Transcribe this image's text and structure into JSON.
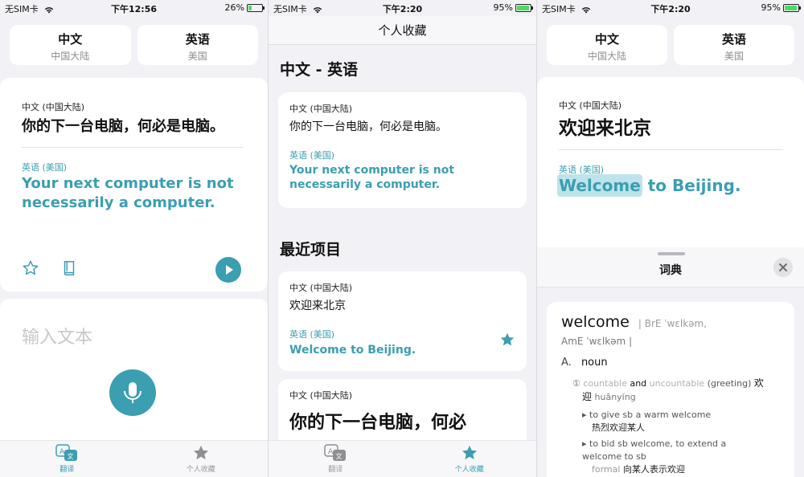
{
  "screen1": {
    "status": {
      "carrier": "无SIM卡",
      "time": "下午12:56",
      "battery": "26%"
    },
    "source_lang": {
      "name": "中文",
      "region": "中国大陆"
    },
    "target_lang": {
      "name": "英语",
      "region": "美国"
    },
    "source_label": "中文 (中国大陆)",
    "source_text": "你的下一台电脑，何必是电脑。",
    "target_label": "英语 (美国)",
    "target_text": "Your next computer is not necessarily a computer.",
    "input_placeholder": "输入文本",
    "tabs": [
      {
        "label": "翻译",
        "icon": "translate-icon"
      },
      {
        "label": "个人收藏",
        "icon": "star-icon"
      }
    ]
  },
  "screen2": {
    "status": {
      "carrier": "无SIM卡",
      "time": "下午2:20",
      "battery": "95%"
    },
    "title": "个人收藏",
    "favorites_section": "中文 - 英语",
    "favorite": {
      "source_label": "中文 (中国大陆)",
      "source_text": "你的下一台电脑，何必是电脑。",
      "target_label": "英语 (美国)",
      "target_text": "Your next computer is not necessarily a computer."
    },
    "recent_section": "最近项目",
    "recent": [
      {
        "source_label": "中文 (中国大陆)",
        "source_text": "欢迎来北京",
        "target_label": "英语 (美国)",
        "target_text": "Welcome to Beijing."
      },
      {
        "source_label": "中文 (中国大陆)",
        "source_text": "你的下一台电脑，何必"
      }
    ],
    "tabs": [
      {
        "label": "翻译",
        "icon": "translate-icon"
      },
      {
        "label": "个人收藏",
        "icon": "star-icon"
      }
    ]
  },
  "screen3": {
    "status": {
      "carrier": "无SIM卡",
      "time": "下午2:20",
      "battery": "95%"
    },
    "source_lang": {
      "name": "中文",
      "region": "中国大陆"
    },
    "target_lang": {
      "name": "英语",
      "region": "美国"
    },
    "source_label": "中文 (中国大陆)",
    "source_text": "欢迎来北京",
    "target_label": "英语 (美国)",
    "target_highlight": "Welcome",
    "target_rest": " to Beijing.",
    "dict_title": "词典",
    "dict": {
      "headword": "welcome",
      "pron_bre": "| BrE ˈwɛlkəm,",
      "pron_ame": "AmE ˈwɛlkəm |",
      "pos_letter": "A.",
      "pos": "noun",
      "sense_num": "①",
      "sense_grammar_1": "countable",
      "sense_and": "and",
      "sense_grammar_2": "uncountable",
      "sense_gloss": "(greeting)",
      "sense_cn": "欢",
      "sense_cn2": "迎",
      "sense_pinyin": "huānyíng",
      "examples": [
        {
          "en": "to give sb a warm welcome",
          "cn": "热烈欢迎某人"
        },
        {
          "en": "to bid sb welcome, to extend a welcome to sb",
          "register": "formal",
          "cn": "向某人表示欢迎"
        }
      ]
    }
  },
  "colors": {
    "accent": "#3b9eb1",
    "background": "#f2f2f6",
    "card": "#ffffff"
  }
}
